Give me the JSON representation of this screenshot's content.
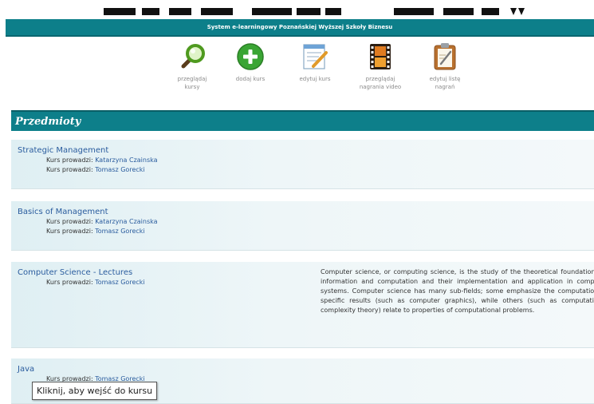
{
  "header": {
    "title": "System e-learningowy Poznańskiej Wyższej Szkoły Biznesu"
  },
  "toolbar": {
    "browse_courses": {
      "label_l1": "przeglądaj",
      "label_l2": "kursy",
      "icon": "magnifier-icon"
    },
    "add_course": {
      "label_l1": "dodaj kurs",
      "icon": "add-plus-icon"
    },
    "edit_course": {
      "label_l1": "edytuj kurs",
      "icon": "edit-document-icon"
    },
    "browse_videos": {
      "label_l1": "przeglądaj",
      "label_l2": "nagrania video",
      "icon": "film-strip-icon"
    },
    "edit_recordings": {
      "label_l1": "edytuj listę",
      "label_l2": "nagrań",
      "icon": "clipboard-icon"
    }
  },
  "section": {
    "title": "Przedmioty"
  },
  "teacher_prefix": "Kurs prowadzi:",
  "courses": [
    {
      "title": "Strategic Management",
      "teachers": [
        "Katarzyna Czainska",
        "Tomasz Gorecki"
      ],
      "description": ""
    },
    {
      "title": "Basics of Management",
      "teachers": [
        "Katarzyna Czainska",
        "Tomasz Gorecki"
      ],
      "description": ""
    },
    {
      "title": "Computer Science - Lectures",
      "teachers": [
        "Tomasz Gorecki"
      ],
      "description": "Computer science, or computing science, is the study of the theoretical foundations of information and computation and their implementation and application in computer systems. Computer science has many sub-fields; some emphasize the computation of specific results (such as computer graphics), while others (such as computational complexity theory) relate to properties of computational problems."
    },
    {
      "title": "Java",
      "teachers": [
        "Tomasz Gorecki"
      ],
      "description": ""
    }
  ],
  "tooltip": {
    "text": "Kliknij, aby wejść do kursu"
  },
  "colors": {
    "teal": "#0d7f8a",
    "link": "#2a5c9e",
    "green": "#3aa534"
  }
}
